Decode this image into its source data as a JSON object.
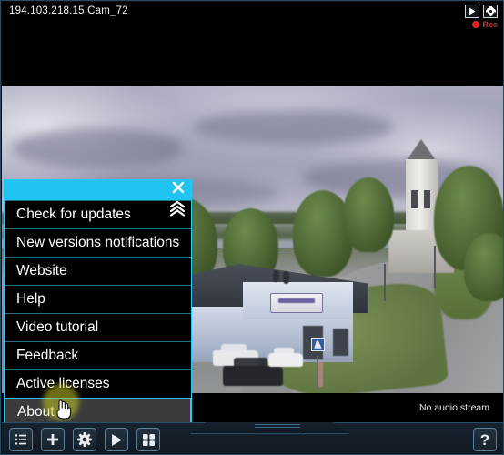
{
  "camera": {
    "label": "194.103.218.15 Cam_72",
    "no_audio_text": "No audio stream",
    "rec_label": "Rec",
    "controls": [
      {
        "name": "play-icon",
        "title": "Play"
      },
      {
        "name": "gear-icon",
        "title": "Settings"
      }
    ]
  },
  "menu": {
    "close_icon": "close-icon",
    "collapse_icon": "chevron-up-double-icon",
    "header_color": "#20c4f0",
    "hover_background": "#3b3b3b",
    "items": [
      {
        "label": "Check for updates",
        "hovered": false
      },
      {
        "label": "New versions notifications",
        "hovered": false
      },
      {
        "label": "Website",
        "hovered": false
      },
      {
        "label": "Help",
        "hovered": false
      },
      {
        "label": "Video tutorial",
        "hovered": false
      },
      {
        "label": "Feedback",
        "hovered": false
      },
      {
        "label": "Active licenses",
        "hovered": false
      },
      {
        "label": "About",
        "hovered": true
      }
    ]
  },
  "toolbar": {
    "left_buttons": [
      {
        "name": "camera-list-button",
        "icon": "list-icon",
        "title": "Camera list"
      },
      {
        "name": "add-camera-button",
        "icon": "plus-icon",
        "title": "Add camera"
      },
      {
        "name": "settings-button",
        "icon": "gear-icon",
        "title": "Settings"
      },
      {
        "name": "play-button",
        "icon": "play-icon",
        "title": "Play"
      },
      {
        "name": "grid-layout-button",
        "icon": "grid-icon",
        "title": "Grid layout"
      }
    ],
    "right_buttons": [
      {
        "name": "help-button",
        "icon": "question-icon",
        "label": "?",
        "title": "Help"
      }
    ]
  },
  "colors": {
    "accent_cyan": "#20c4f0",
    "panel_dark": "#101a24",
    "rec_red": "#e8201c",
    "border_blue": "#2a4f68"
  }
}
